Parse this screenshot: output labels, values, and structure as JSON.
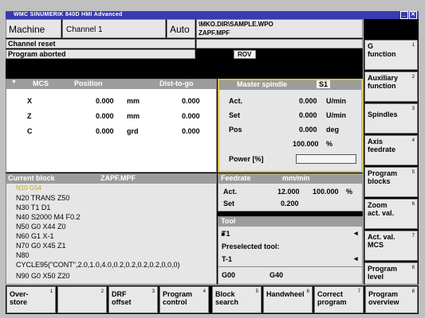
{
  "window": {
    "title": "WMC  SINUMERIK 840D  HMI  Advanced"
  },
  "header": {
    "area": "Machine",
    "channel": "Channel 1",
    "mode": "Auto",
    "path": "\\MKO.DIR\\SAMPLE.WPO",
    "program": "ZAPF.MPF",
    "channel_status": "Channel reset",
    "program_status": "Program aborted",
    "rov": "ROV"
  },
  "axes": {
    "col_axis": "MCS",
    "col_position": "Position",
    "col_dist": "Dist-to-go",
    "rows": [
      {
        "name": "X",
        "pos": "0.000",
        "unit": "mm",
        "dist": "0.000"
      },
      {
        "name": "Z",
        "pos": "0.000",
        "unit": "mm",
        "dist": "0.000"
      },
      {
        "name": "C",
        "pos": "0.000",
        "unit": "grd",
        "dist": "0.000"
      }
    ]
  },
  "spindle": {
    "title": "Master spindle",
    "num": "S1",
    "act_label": "Act.",
    "act_value": "0.000",
    "act_unit": "U/min",
    "set_label": "Set",
    "set_value": "0.000",
    "set_unit": "U/min",
    "pos_label": "Pos",
    "pos_value": "0.000",
    "pos_unit": "deg",
    "override_value": "100.000",
    "override_unit": "%",
    "power_label": "Power [%]"
  },
  "block": {
    "title": "Current block",
    "program": "ZAPF.MPF",
    "lines": [
      "N10 G54",
      "N20 TRANS Z50",
      "N30 T1 D1",
      "N40 S2000 M4 F0.2",
      "N50 G0 X44 Z0",
      "N60 G1 X-1",
      "N70 G0 X45 Z1",
      "N80",
      "CYCLE95(\"CONT\",2.0,1.0,4.0,0.2,0.2,0.2,0.2,0,0,0)",
      "N90 G0 X50 Z20"
    ]
  },
  "feed": {
    "title": "Feedrate",
    "unit": "mm/min",
    "act_label": "Act.",
    "act_value": "12.000",
    "act_percent": "100.000",
    "act_pct_unit": "%",
    "set_label": "Set",
    "set_value": "0.200"
  },
  "tool": {
    "title": "Tool",
    "current": "T1",
    "preselected_label": "Preselected tool:",
    "preselected": "T-1",
    "gcode1": "G00",
    "gcode2": "G40"
  },
  "softkeys_v": [
    {
      "l1": "G",
      "l2": "function",
      "n": "1"
    },
    {
      "l1": "Auxiliary",
      "l2": "function",
      "n": "2"
    },
    {
      "l1": "Spindles",
      "l2": "",
      "n": "3"
    },
    {
      "l1": "Axis",
      "l2": "feedrate",
      "n": "4"
    },
    {
      "l1": "Program",
      "l2": "blocks",
      "n": "5"
    },
    {
      "l1": "Zoom",
      "l2": "act. val.",
      "n": "6"
    },
    {
      "l1": "Act. val.",
      "l2": "MCS",
      "n": "7"
    },
    {
      "l1": "Program",
      "l2": "level",
      "n": "8"
    }
  ],
  "softkeys_h": [
    {
      "l1": "Over-",
      "l2": "store",
      "n": "1"
    },
    {
      "l1": "",
      "l2": "",
      "n": "2"
    },
    {
      "l1": "DRF",
      "l2": "offset",
      "n": "3"
    },
    {
      "l1": "Program",
      "l2": "control",
      "n": "4"
    },
    {
      "l1": "Block",
      "l2": "search",
      "n": "5"
    },
    {
      "l1": "Handwheel",
      "l2": "",
      "n": "6"
    },
    {
      "l1": "Correct",
      "l2": "program",
      "n": "7"
    },
    {
      "l1": "Program",
      "l2": "overview",
      "n": "8"
    }
  ]
}
